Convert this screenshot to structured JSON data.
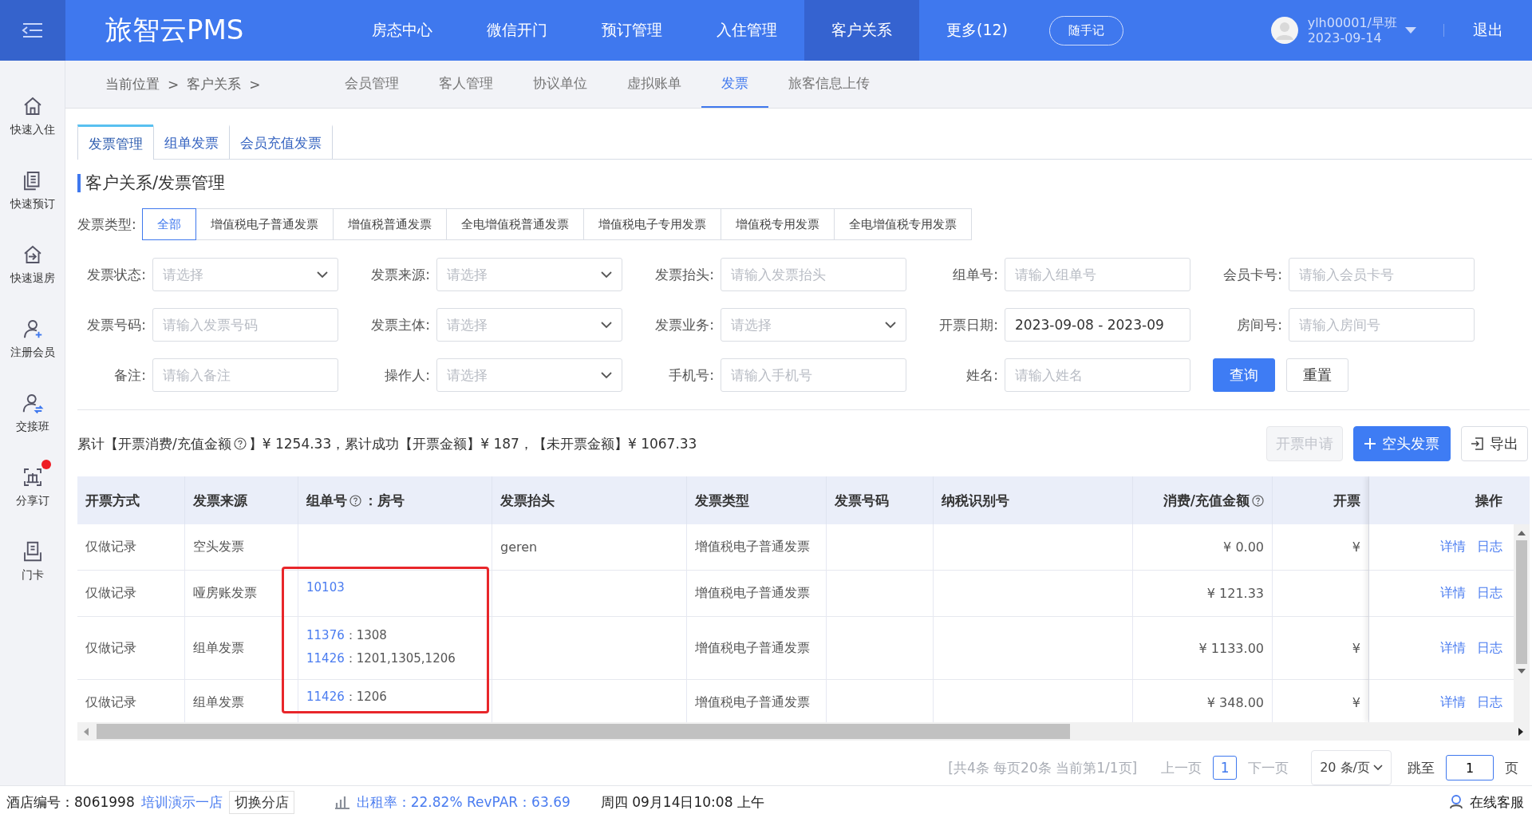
{
  "header": {
    "logo": "旅智云PMS",
    "nav": [
      {
        "label": "房态中心",
        "selected": false
      },
      {
        "label": "微信开门",
        "selected": false
      },
      {
        "label": "预订管理",
        "selected": false
      },
      {
        "label": "入住管理",
        "selected": false
      },
      {
        "label": "客户关系",
        "selected": true
      },
      {
        "label": "更多(12)",
        "selected": false
      }
    ],
    "note_button": "随手记",
    "user": {
      "name": "ylh00001/早班",
      "date": "2023-09-14"
    },
    "logout": "退出"
  },
  "sidebar": {
    "items": [
      {
        "label": "快速入住",
        "alert": false
      },
      {
        "label": "快速预订",
        "alert": false
      },
      {
        "label": "快速退房",
        "alert": false
      },
      {
        "label": "注册会员",
        "alert": false
      },
      {
        "label": "交接班",
        "alert": false
      },
      {
        "label": "分享订",
        "alert": true
      },
      {
        "label": "门卡",
        "alert": false
      }
    ]
  },
  "breadcrumb": [
    {
      "label": "当前位置",
      "separator": ">"
    },
    {
      "label": "客户关系",
      "separator": ">"
    }
  ],
  "subnav": [
    {
      "label": "会员管理",
      "selected": false
    },
    {
      "label": "客人管理",
      "selected": false
    },
    {
      "label": "协议单位",
      "selected": false
    },
    {
      "label": "虚拟账单",
      "selected": false
    },
    {
      "label": "发票",
      "selected": true
    },
    {
      "label": "旅客信息上传",
      "selected": false
    }
  ],
  "tabs": [
    {
      "label": "发票管理",
      "selected": true
    },
    {
      "label": "组单发票",
      "selected": false
    },
    {
      "label": "会员充值发票",
      "selected": false
    }
  ],
  "section_title": "客户关系/发票管理",
  "invoice_type": {
    "label": "发票类型:",
    "options": [
      {
        "label": "全部",
        "selected": true
      },
      {
        "label": "增值税电子普通发票",
        "selected": false
      },
      {
        "label": "增值税普通发票",
        "selected": false
      },
      {
        "label": "全电增值税普通发票",
        "selected": false
      },
      {
        "label": "增值税电子专用发票",
        "selected": false
      },
      {
        "label": "增值税专用发票",
        "selected": false
      },
      {
        "label": "全电增值税专用发票",
        "selected": false
      }
    ]
  },
  "filters": [
    [
      {
        "label": "发票状态:",
        "kind": "select",
        "placeholder": "请选择"
      },
      {
        "label": "发票来源:",
        "kind": "select",
        "placeholder": "请选择"
      },
      {
        "label": "发票抬头:",
        "kind": "input",
        "placeholder": "请输入发票抬头"
      },
      {
        "label": "组单号:",
        "kind": "input",
        "placeholder": "请输入组单号"
      },
      {
        "label": "会员卡号:",
        "kind": "input",
        "placeholder": "请输入会员卡号"
      }
    ],
    [
      {
        "label": "发票号码:",
        "kind": "input",
        "placeholder": "请输入发票号码"
      },
      {
        "label": "发票主体:",
        "kind": "select",
        "placeholder": "请选择"
      },
      {
        "label": "发票业务:",
        "kind": "select",
        "placeholder": "请选择"
      },
      {
        "label": "开票日期:",
        "kind": "input",
        "value": "2023-09-08 - 2023-09"
      },
      {
        "label": "房间号:",
        "kind": "input",
        "placeholder": "请输入房间号"
      }
    ],
    [
      {
        "label": "备注:",
        "kind": "input",
        "placeholder": "请输入备注"
      },
      {
        "label": "操作人:",
        "kind": "select",
        "placeholder": "请选择"
      },
      {
        "label": "手机号:",
        "kind": "input",
        "placeholder": "请输入手机号"
      },
      {
        "label": "姓名:",
        "kind": "input",
        "placeholder": "请输入姓名"
      }
    ]
  ],
  "form_buttons": [
    {
      "label": "查询",
      "kind": "primary"
    },
    {
      "label": "重置",
      "kind": "default"
    }
  ],
  "summary": {
    "before": "累计【开票消费/充值金额",
    "after": "】¥ 1254.33，累计成功【开票金额】¥ 187，【未开票金额】¥ 1067.33"
  },
  "actions": [
    {
      "label": "开票申请",
      "kind": "default",
      "disabled": true
    },
    {
      "label": "空头发票",
      "kind": "add",
      "disabled": false
    },
    {
      "label": "导出",
      "kind": "export",
      "disabled": false
    }
  ],
  "table": {
    "highlight": true,
    "columns": [
      {
        "label": "开票方式",
        "help": false
      },
      {
        "label": "发票来源",
        "help": false
      },
      {
        "label": "组单号",
        "help": true,
        "suffix": "：房号"
      },
      {
        "label": "发票抬头",
        "help": false
      },
      {
        "label": "发票类型",
        "help": false
      },
      {
        "label": "发票号码",
        "help": false
      },
      {
        "label": "纳税识别号",
        "help": false
      },
      {
        "label": "消费/充值金额",
        "help": true
      },
      {
        "label": "开票",
        "help": false
      }
    ],
    "action_column": "操作",
    "rows": [
      {
        "cells": [
          "仅做记录",
          "空头发票",
          null,
          "geren",
          "增值税电子普通发票",
          "",
          "",
          "¥ 0.00",
          "¥"
        ],
        "groups": [],
        "actions": [
          "详情",
          "日志"
        ]
      },
      {
        "cells": [
          "仅做记录",
          "哑房账发票",
          null,
          "",
          "增值税电子普通发票",
          "",
          "",
          "¥ 121.33",
          ""
        ],
        "groups": [
          {
            "order": "10103"
          }
        ],
        "actions": [
          "详情",
          "日志"
        ]
      },
      {
        "cells": [
          "仅做记录",
          "组单发票",
          null,
          "",
          "增值税电子普通发票",
          "",
          "",
          "¥ 1133.00",
          "¥"
        ],
        "groups": [
          {
            "order": "11376",
            "separator": "：",
            "rooms": "1308"
          },
          {
            "order": "11426",
            "separator": "：",
            "rooms": "1201,1305,1206"
          }
        ],
        "actions": [
          "详情",
          "日志"
        ]
      },
      {
        "cells": [
          "仅做记录",
          "组单发票",
          null,
          "",
          "增值税电子普通发票",
          "",
          "",
          "¥ 348.00",
          "¥"
        ],
        "groups": [
          {
            "order": "11426",
            "separator": "：",
            "rooms": "1206"
          }
        ],
        "actions": [
          "详情",
          "日志"
        ]
      }
    ]
  },
  "pagination": {
    "summary": "[共4条 每页20条 当前第1/1页]",
    "prev": "上一页",
    "pages": [
      {
        "label": "1",
        "selected": true
      }
    ],
    "next": "下一页",
    "page_size": "20 条/页",
    "jump_label": "跳至",
    "jump_value": "1",
    "unit": "页"
  },
  "status_bar": {
    "hotel_label": "酒店编号：8061998",
    "hotel_name": "培训演示一店",
    "switch": "切换分店",
    "occupancy": "出租率：22.82% RevPAR：63.69",
    "datetime": "周四 09月14日10:08 上午",
    "support": "在线客服"
  }
}
